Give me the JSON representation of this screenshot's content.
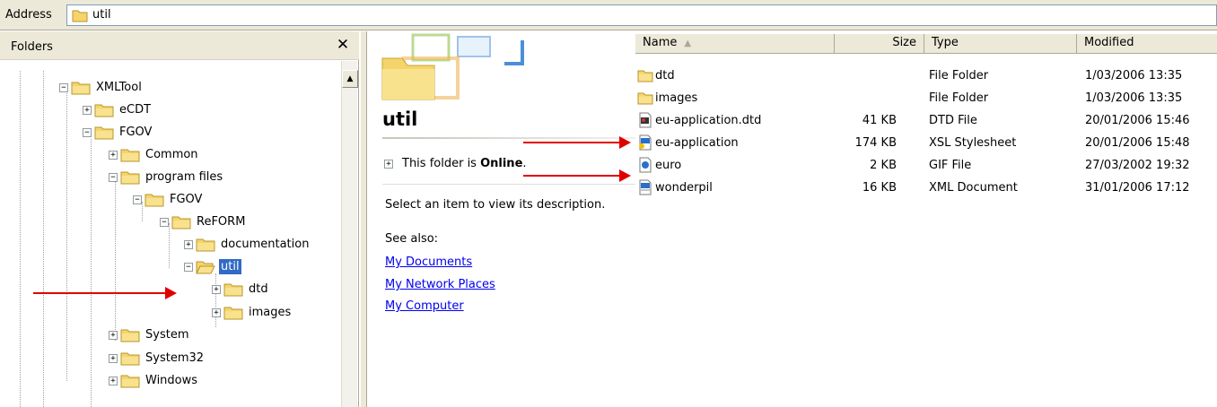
{
  "address": {
    "label": "Address",
    "value": "util"
  },
  "folders": {
    "title": "Folders",
    "close_glyph": "✕",
    "tree": [
      {
        "label": "XMLTool",
        "expander": "−"
      },
      {
        "label": "eCDT",
        "expander": "+"
      },
      {
        "label": "FGOV",
        "expander": "−"
      },
      {
        "label": "Common",
        "expander": "+"
      },
      {
        "label": "program files",
        "expander": "−"
      },
      {
        "label": "FGOV",
        "expander": "−"
      },
      {
        "label": "ReFORM",
        "expander": "−"
      },
      {
        "label": "documentation",
        "expander": "+"
      },
      {
        "label": "util",
        "expander": "−",
        "selected": true
      },
      {
        "label": "dtd",
        "expander": "+"
      },
      {
        "label": "images",
        "expander": "+"
      },
      {
        "label": "System",
        "expander": "+"
      },
      {
        "label": "System32",
        "expander": "+"
      },
      {
        "label": "Windows",
        "expander": "+"
      }
    ]
  },
  "task_pane": {
    "title": "util",
    "online_prefix": "This folder is ",
    "online_status": "Online",
    "online_suffix": ".",
    "description": "Select an item to view its description.",
    "see_also_label": "See also:",
    "links": [
      "My Documents",
      "My Network Places",
      "My Computer"
    ]
  },
  "columns": {
    "name": "Name",
    "size": "Size",
    "type": "Type",
    "modified": "Modified"
  },
  "files": [
    {
      "name": "dtd",
      "size": "",
      "type": "File Folder",
      "modified": "1/03/2006 13:35",
      "icon": "folder-icon"
    },
    {
      "name": "images",
      "size": "",
      "type": "File Folder",
      "modified": "1/03/2006 13:35",
      "icon": "folder-icon"
    },
    {
      "name": "eu-application.dtd",
      "size": "41 KB",
      "type": "DTD File",
      "modified": "20/01/2006 15:46",
      "icon": "dtd-file-icon"
    },
    {
      "name": "eu-application",
      "size": "174 KB",
      "type": "XSL Stylesheet",
      "modified": "20/01/2006 15:48",
      "icon": "xsl-file-icon"
    },
    {
      "name": "euro",
      "size": "2 KB",
      "type": "GIF File",
      "modified": "27/03/2002 19:32",
      "icon": "gif-file-icon"
    },
    {
      "name": "wonderpil",
      "size": "16 KB",
      "type": "XML Document",
      "modified": "31/01/2006 17:12",
      "icon": "xml-file-icon"
    }
  ],
  "colors": {
    "folder": "#f5d56b",
    "selection": "#316ac5",
    "link": "#0000ee",
    "arrow": "#e00000",
    "chrome": "#ece9d8"
  }
}
